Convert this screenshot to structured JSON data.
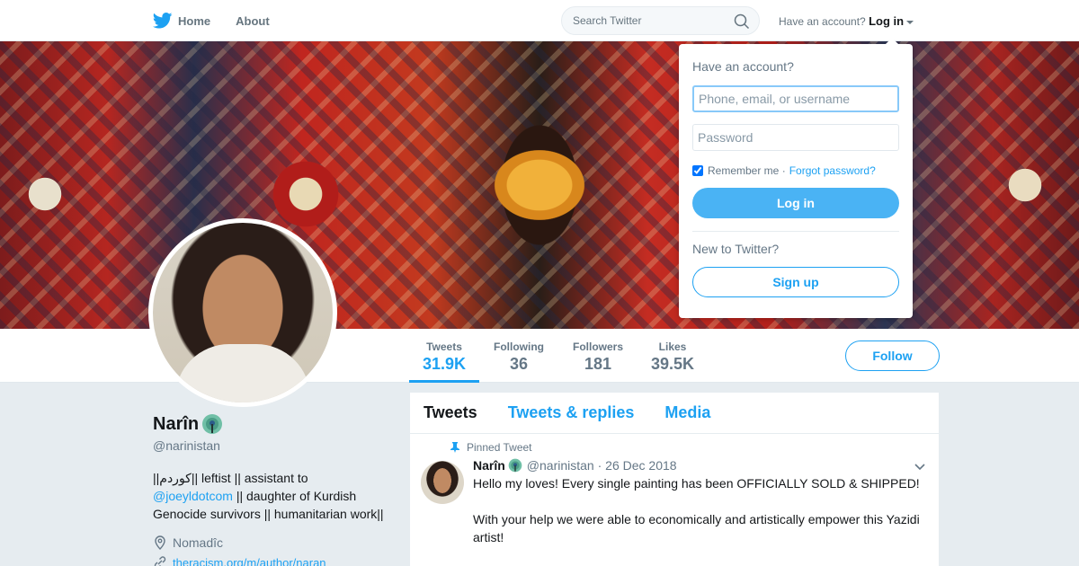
{
  "nav": {
    "home_label": "Home",
    "about_label": "About",
    "search_placeholder": "Search Twitter",
    "have_account": "Have an account?",
    "login_label": "Log in"
  },
  "profile": {
    "name": "Narîn",
    "handle": "@narinistan",
    "bio_part1": "||كوردم|| leftist || assistant to",
    "bio_link": "@joeyldotcom",
    "bio_part2": "|| daughter of Kurdish Genocide survivors || humanitarian work||",
    "location": "Nomadîc",
    "website": "theracism.org/m/author/naran"
  },
  "stats": [
    {
      "label": "Tweets",
      "value": "31.9K"
    },
    {
      "label": "Following",
      "value": "36"
    },
    {
      "label": "Followers",
      "value": "181"
    },
    {
      "label": "Likes",
      "value": "39.5K"
    }
  ],
  "follow_label": "Follow",
  "tabs": [
    "Tweets",
    "Tweets & replies",
    "Media"
  ],
  "tweet": {
    "pinned_label": "Pinned Tweet",
    "name": "Narîn",
    "handle": "@narinistan",
    "date": "· 26 Dec 2018",
    "line1": "Hello my loves! Every single painting has been OFFICIALLY SOLD & SHIPPED!",
    "line2": "With your help we were able to economically and artistically empower this Yazidi artist!"
  },
  "login": {
    "title": "Have an account?",
    "username_placeholder": "Phone, email, or username",
    "password_placeholder": "Password",
    "remember": "Remember me",
    "separator": "·",
    "forgot": "Forgot password?",
    "login_button": "Log in",
    "new_to": "New to Twitter?",
    "signup_button": "Sign up"
  },
  "colors": {
    "accent": "#1da1f2",
    "login_button": "#4ab3f4",
    "background": "#e6ecf0"
  },
  "icons": [
    "twitter-bird-icon",
    "home-icon",
    "search-icon",
    "caret-down-icon",
    "peacock-emoji-icon",
    "location-pin-icon",
    "link-icon",
    "pin-icon",
    "chevron-down-icon"
  ]
}
